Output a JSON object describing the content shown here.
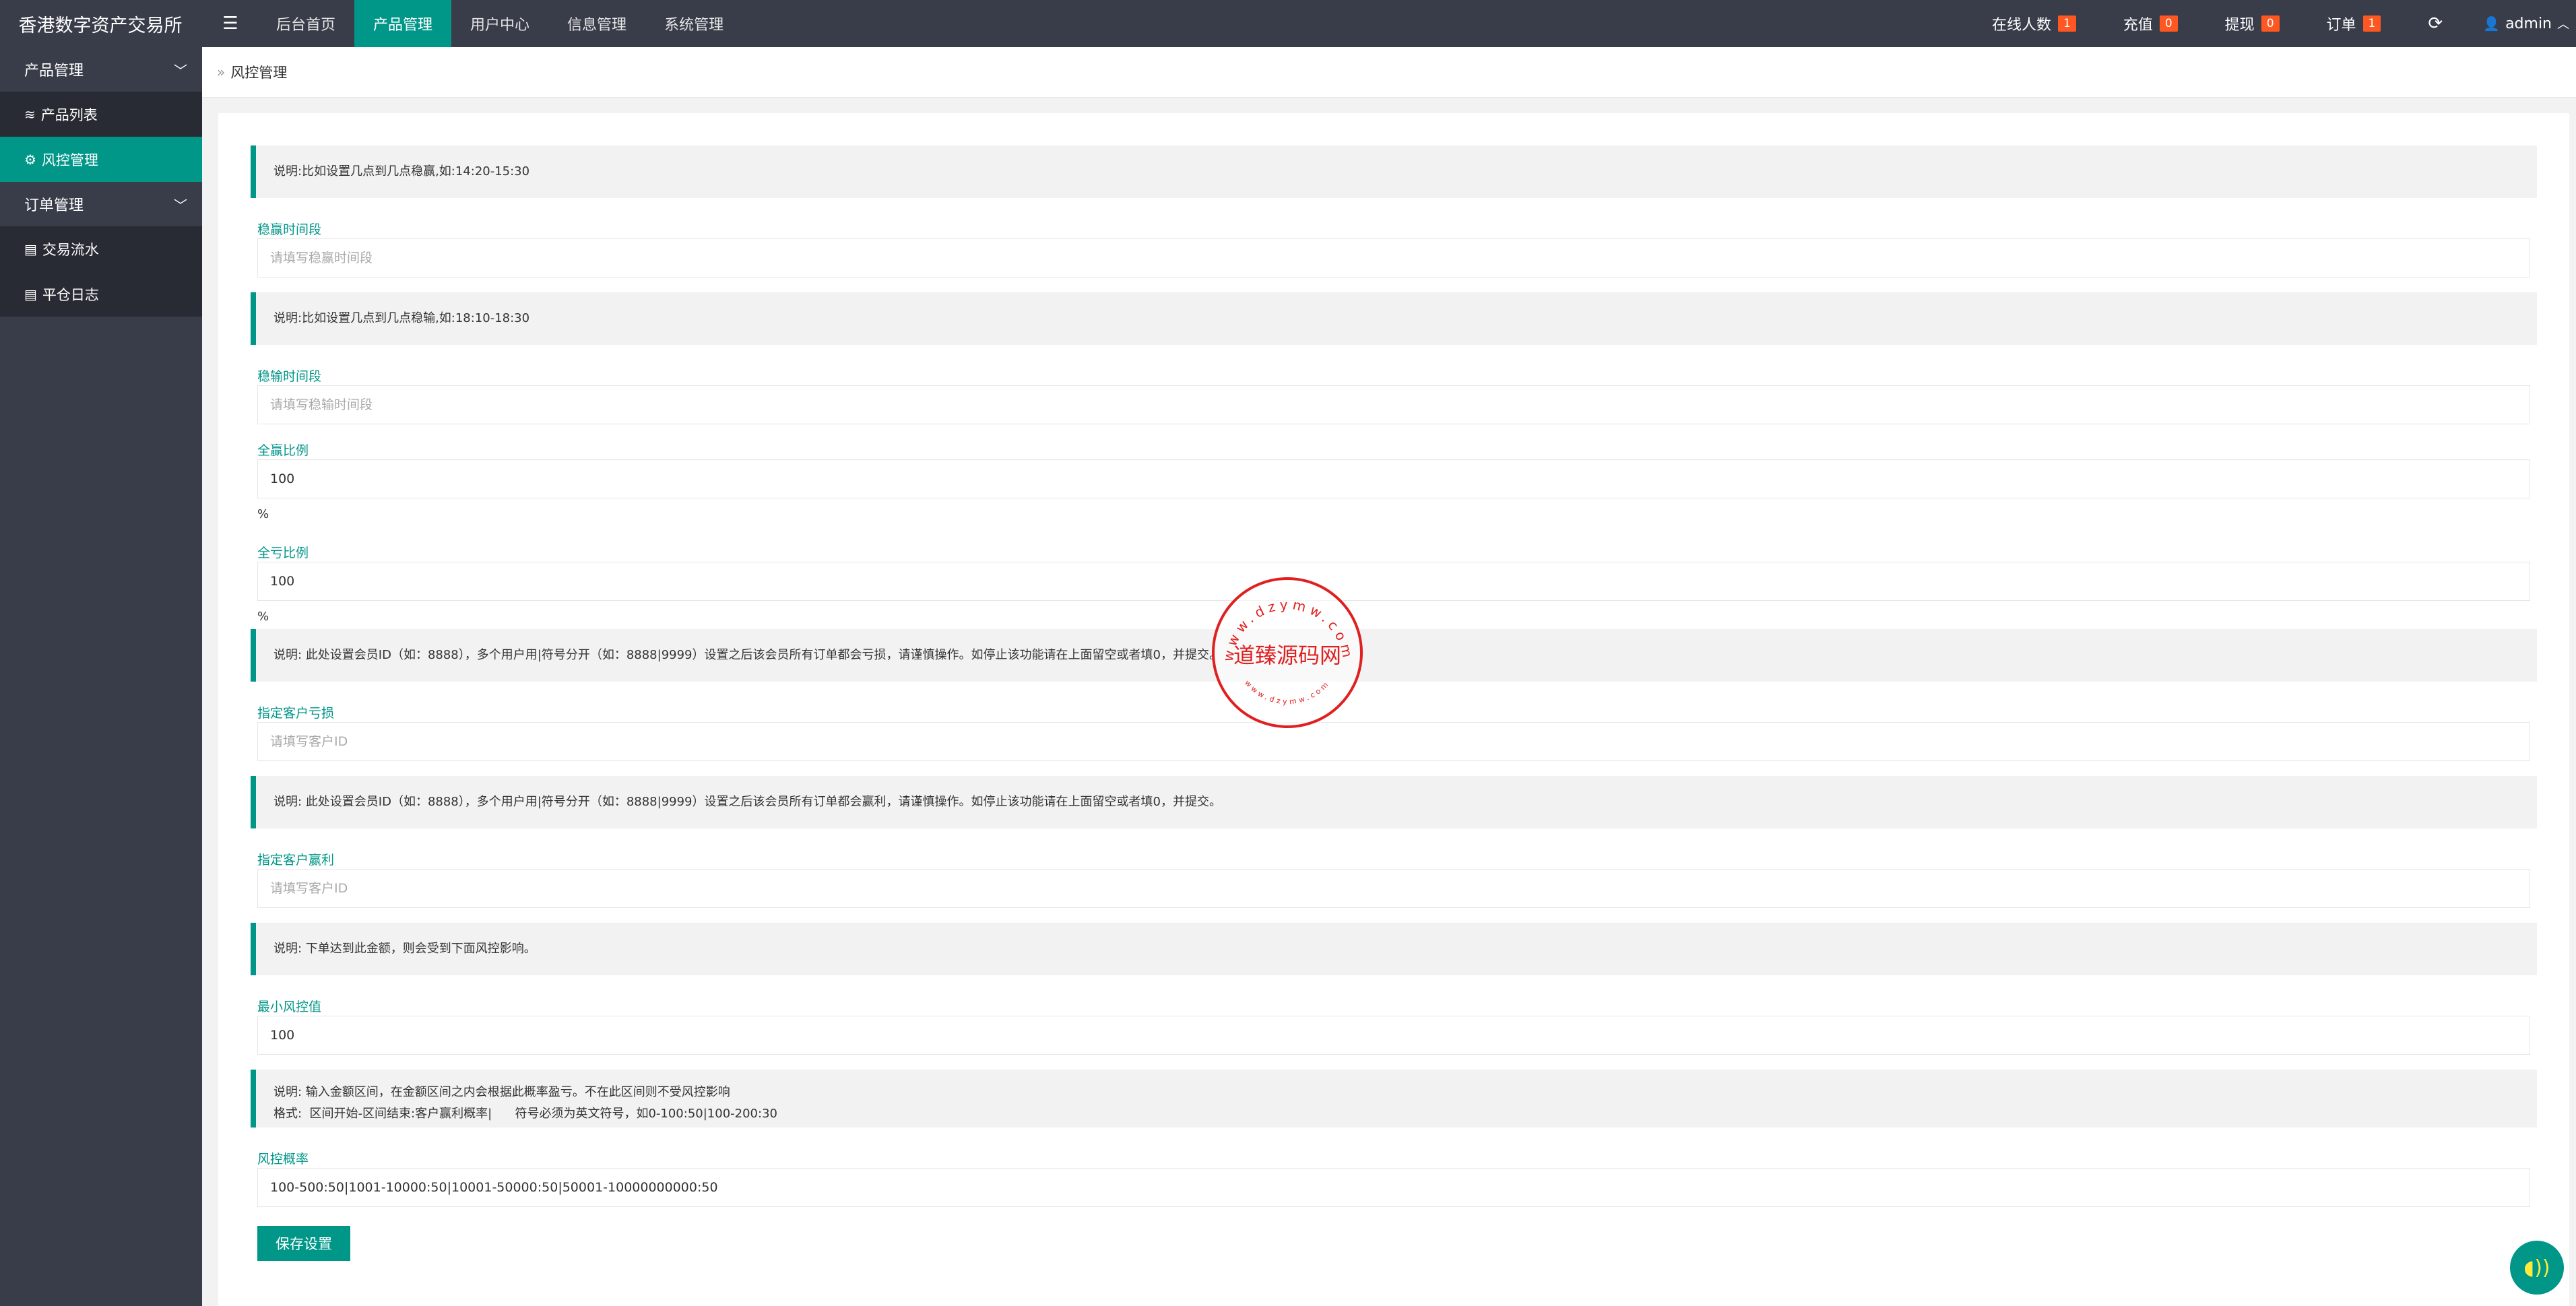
{
  "app": {
    "title": "香港数字资产交易所"
  },
  "header": {
    "menu_icon": "hamburger-icon",
    "nav": [
      {
        "label": "后台首页",
        "active": false
      },
      {
        "label": "产品管理",
        "active": true
      },
      {
        "label": "用户中心",
        "active": false
      },
      {
        "label": "信息管理",
        "active": false
      },
      {
        "label": "系统管理",
        "active": false
      }
    ],
    "stats": [
      {
        "label": "在线人数",
        "count": "1"
      },
      {
        "label": "充值",
        "count": "0"
      },
      {
        "label": "提现",
        "count": "0"
      },
      {
        "label": "订单",
        "count": "1"
      }
    ],
    "user": "admin"
  },
  "sidebar": {
    "groups": [
      {
        "label": "产品管理",
        "items": [
          {
            "label": "产品列表",
            "icon": "layers-icon"
          },
          {
            "label": "风控管理",
            "icon": "gear-icon"
          }
        ]
      },
      {
        "label": "订单管理",
        "items": [
          {
            "label": "交易流水",
            "icon": "document-icon"
          },
          {
            "label": "平仓日志",
            "icon": "document-icon"
          }
        ]
      }
    ]
  },
  "breadcrumb": "风控管理",
  "form": {
    "win_note": "说明:比如设置几点到几点稳赢,如:14:20-15:30",
    "win_label": "稳赢时间段",
    "win_placeholder": "请填写稳赢时间段",
    "lose_note": "说明:比如设置几点到几点稳输,如:18:10-18:30",
    "lose_label": "稳输时间段",
    "lose_placeholder": "请填写稳输时间段",
    "allwin_label": "全赢比例",
    "allwin_value": "100",
    "allwin_unit": "%",
    "alllose_label": "全亏比例",
    "alllose_value": "100",
    "alllose_unit": "%",
    "loss_note": "说明:  此处设置会员ID（如：8888），多个用户用|符号分开（如：8888|9999）设置之后该会员所有订单都会亏损，请谨慎操作。如停止该功能请在上面留空或者填0，并提交。",
    "loss_label": "指定客户亏损",
    "loss_placeholder": "请填写客户ID",
    "profit_note": "说明:  此处设置会员ID（如：8888），多个用户用|符号分开（如：8888|9999）设置之后该会员所有订单都会赢利，请谨慎操作。如停止该功能请在上面留空或者填0，并提交。",
    "profit_label": "指定客户赢利",
    "profit_placeholder": "请填写客户ID",
    "min_note": "说明:  下单达到此金额，则会受到下面风控影响。",
    "min_label": "最小风控值",
    "min_value": "100",
    "prob_note_1": "说明:  输入金额区间，在金额区间之内会根据此概率盈亏。不在此区间则不受风控影响",
    "prob_note_2": "格式:  区间开始-区间结束:客户赢利概率|      符号必须为英文符号，如0-100:50|100-200:30",
    "prob_label": "风控概率",
    "prob_value": "100-500:50|1001-10000:50|10001-50000:50|50001-10000000000:50",
    "save_label": "保存设置"
  },
  "watermark": {
    "top_text": "www.dzymw.com",
    "center_text": "道臻源码网",
    "bottom_text": "www.dzymw.com"
  },
  "colors": {
    "primary": "#009688",
    "dark": "#393d49",
    "badge": "#ff5722",
    "seal": "#e02020"
  }
}
